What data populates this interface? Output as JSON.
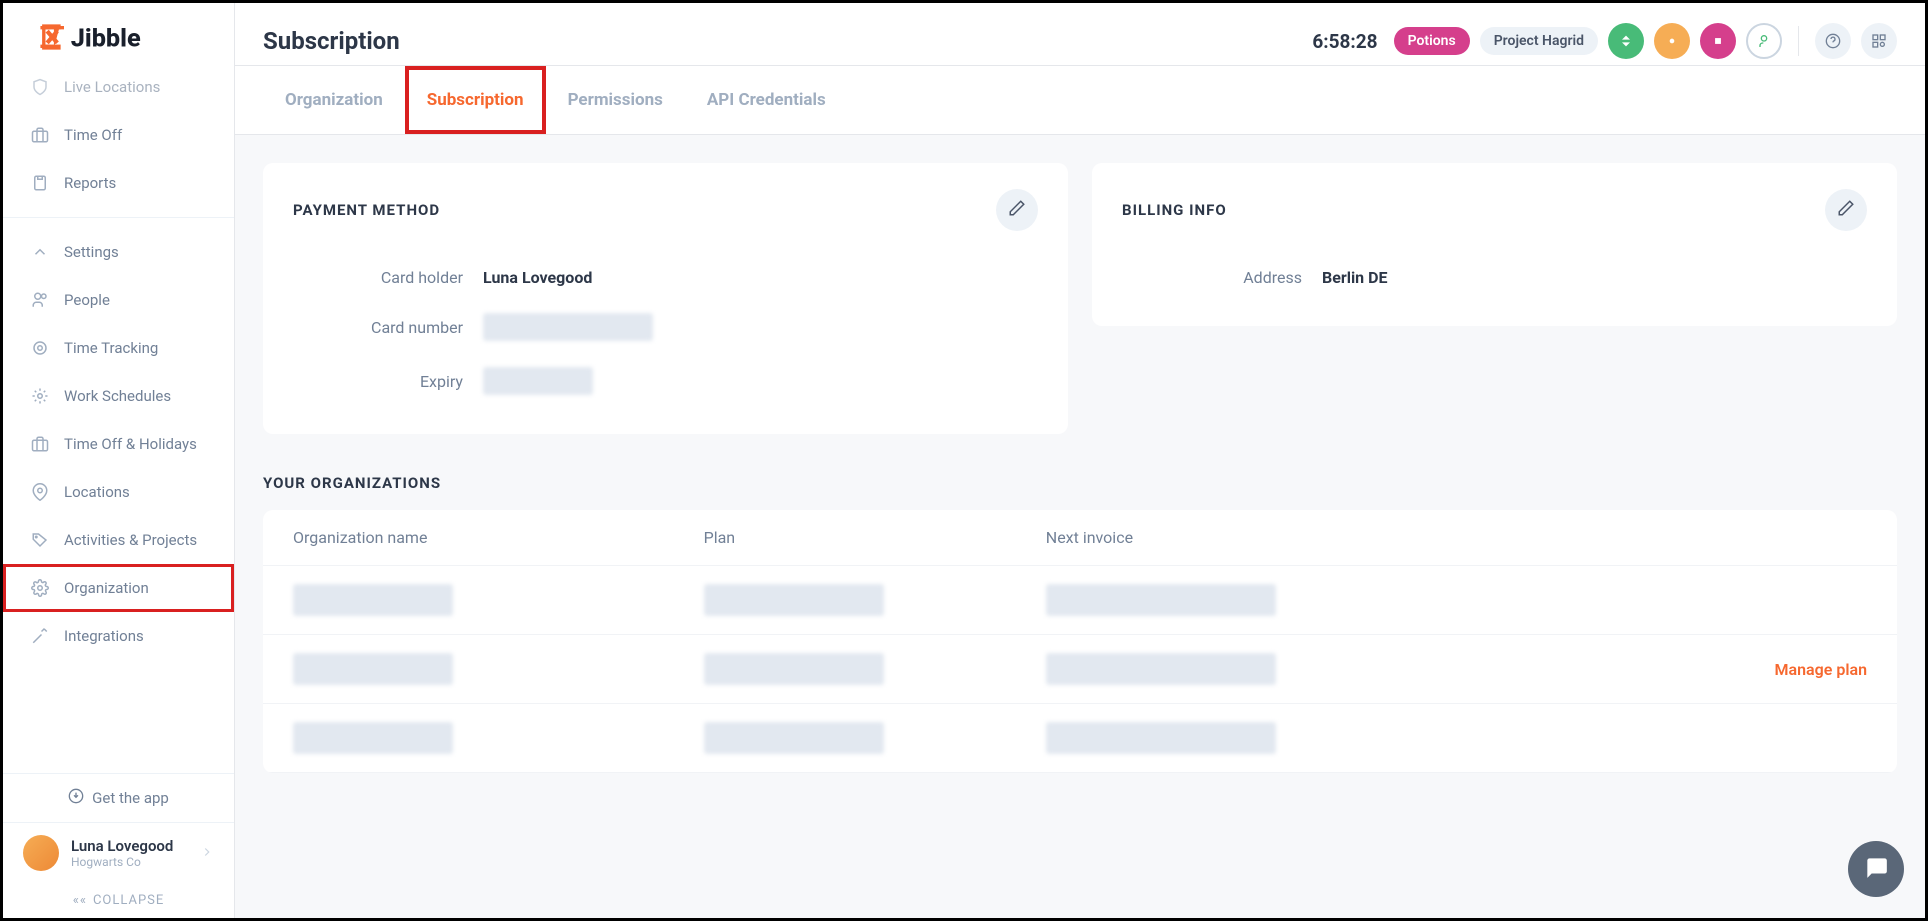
{
  "logo_text": "Jibble",
  "page_title": "Subscription",
  "timer": "6:58:28",
  "pills": {
    "activity": "Potions",
    "project": "Project Hagrid"
  },
  "sidebar": {
    "items": [
      {
        "label": "Live Locations",
        "icon": "shield"
      },
      {
        "label": "Time Off",
        "icon": "briefcase"
      },
      {
        "label": "Reports",
        "icon": "clipboard"
      }
    ],
    "items2": [
      {
        "label": "Settings",
        "icon": "chevron"
      },
      {
        "label": "People",
        "icon": "users"
      },
      {
        "label": "Time Tracking",
        "icon": "target"
      },
      {
        "label": "Work Schedules",
        "icon": "calendar-cog"
      },
      {
        "label": "Time Off & Holidays",
        "icon": "briefcase"
      },
      {
        "label": "Locations",
        "icon": "pin"
      },
      {
        "label": "Activities & Projects",
        "icon": "tag"
      },
      {
        "label": "Organization",
        "icon": "gear",
        "highlighted": true
      },
      {
        "label": "Integrations",
        "icon": "plug"
      }
    ],
    "get_app": "Get the app",
    "user": {
      "name": "Luna Lovegood",
      "org": "Hogwarts Co"
    },
    "collapse": "COLLAPSE"
  },
  "tabs": [
    {
      "label": "Organization",
      "active": false
    },
    {
      "label": "Subscription",
      "active": true
    },
    {
      "label": "Permissions",
      "active": false
    },
    {
      "label": "API Credentials",
      "active": false
    }
  ],
  "payment": {
    "title": "PAYMENT METHOD",
    "holder_label": "Card holder",
    "holder_value": "Luna Lovegood",
    "number_label": "Card number",
    "expiry_label": "Expiry"
  },
  "billing": {
    "title": "BILLING INFO",
    "address_label": "Address",
    "address_value": "Berlin DE"
  },
  "orgs": {
    "title": "YOUR ORGANIZATIONS",
    "cols": {
      "name": "Organization name",
      "plan": "Plan",
      "invoice": "Next invoice"
    },
    "manage": "Manage plan"
  }
}
